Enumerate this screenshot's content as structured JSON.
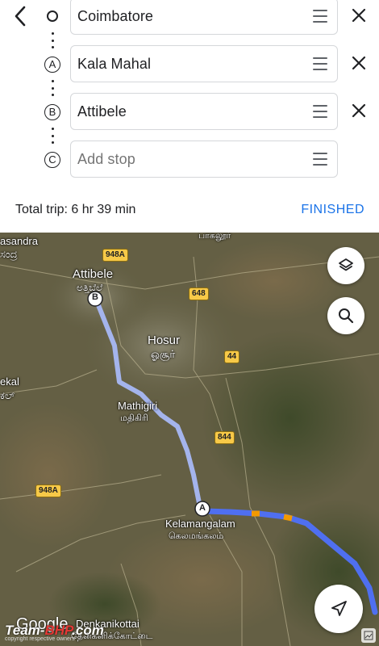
{
  "header": {
    "back_icon": "chevron-left-icon"
  },
  "stops": [
    {
      "marker": "",
      "value": "Coimbatore",
      "placeholder": ""
    },
    {
      "marker": "A",
      "value": "Kala Mahal",
      "placeholder": ""
    },
    {
      "marker": "B",
      "value": "Attibele",
      "placeholder": ""
    },
    {
      "marker": "C",
      "value": "",
      "placeholder": "Add stop"
    }
  ],
  "trip": {
    "total": "Total trip: 6 hr 39 min",
    "finished_label": "FINISHED"
  },
  "map": {
    "labels": {
      "asandra": "asandra",
      "asandra_kn": "ಸಂದ್ರ",
      "attibele": "Attibele",
      "attibele_kn": "ಅತ್ತಿಬೆಲೆ",
      "top_tamil": "பாகலூர்",
      "hosur": "Hosur",
      "hosur_ta": "ஓசூர்",
      "ekal": "ekal",
      "ekal_kn": "ಕಲ್",
      "mathigiri": "Mathigiri",
      "mathigiri_ta": "மதிகிரி",
      "kelamangalam": "Kelamangalam",
      "kelamangalam_ta": "கெலமங்கலம்",
      "denkanikottai": "Denkanikottai",
      "denkanikottai_ta": "தேன்கனிக்கோட்டை"
    },
    "roads": {
      "r948a_top": "948A",
      "r648": "648",
      "r44": "44",
      "r844": "844",
      "r948a_bottom": "948A"
    },
    "markers": {
      "a": "A",
      "b": "B"
    },
    "branding": {
      "google": "Google",
      "watermark_main": "Team-",
      "watermark_accent": "BHP",
      "watermark_tail": ".com",
      "copyright": "copyright respective owners"
    },
    "colors": {
      "route_primary": "#4f6ff0",
      "route_alt": "#a8b8f5",
      "traffic_orange": "#f29900",
      "accent_blue": "#1a73e8"
    },
    "icons": [
      "layers-icon",
      "search-icon",
      "navigation-arrow-icon"
    ]
  }
}
